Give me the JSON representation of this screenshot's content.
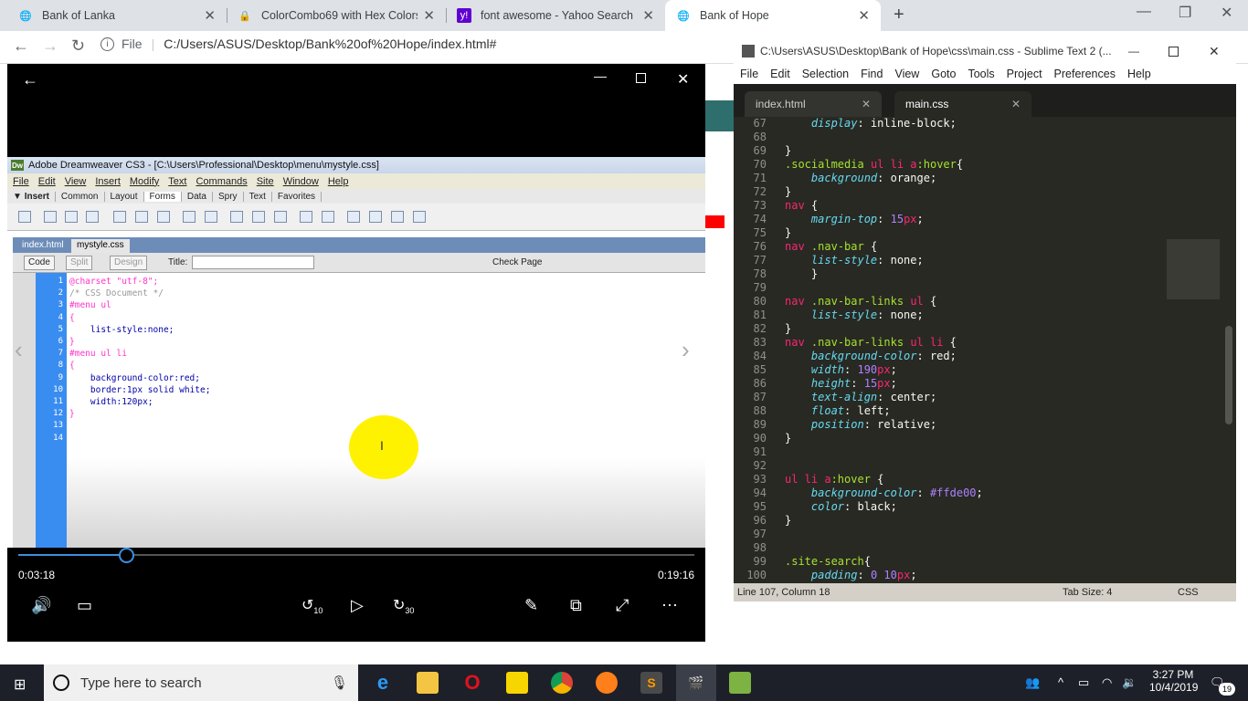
{
  "browser": {
    "tabs": [
      {
        "title": "Bank of Lanka"
      },
      {
        "title": "ColorCombo69 with Hex Colors #"
      },
      {
        "title": "font awesome - Yahoo Search Re"
      },
      {
        "title": "Bank of Hope"
      }
    ],
    "file_label": "File",
    "url": "C:/Users/ASUS/Desktop/Bank%20of%20Hope/index.html#"
  },
  "dreamweaver": {
    "title": "Adobe Dreamweaver CS3 - [C:\\Users\\Professional\\Desktop\\menu\\mystyle.css]",
    "menu": [
      "File",
      "Edit",
      "View",
      "Insert",
      "Modify",
      "Text",
      "Commands",
      "Site",
      "Window",
      "Help"
    ],
    "insert_tabs": [
      "Insert",
      "Common",
      "Layout",
      "Forms",
      "Data",
      "Spry",
      "Text",
      "Favorites"
    ],
    "file_tabs": [
      "index.html",
      "mystyle.css"
    ],
    "view_buttons": [
      "Code",
      "Split",
      "Design"
    ],
    "title_label": "Title:",
    "check_page": "Check Page",
    "line_numbers": "1\n2\n3\n4\n5\n6\n7\n8\n9\n10\n11\n12\n13\n14"
  },
  "player": {
    "elapsed": "0:03:18",
    "duration": "0:19:16",
    "progress": 0.16,
    "skip_back": "10",
    "skip_fwd": "30"
  },
  "sublime": {
    "title": "C:\\Users\\ASUS\\Desktop\\Bank of Hope\\css\\main.css - Sublime Text 2 (...",
    "menu": [
      "File",
      "Edit",
      "Selection",
      "Find",
      "View",
      "Goto",
      "Tools",
      "Project",
      "Preferences",
      "Help"
    ],
    "tabs": [
      "index.html",
      "main.css"
    ],
    "status_left": "Line 107, Column 18",
    "status_tab": "Tab Size: 4",
    "status_syntax": "CSS"
  },
  "taskbar": {
    "search_placeholder": "Type here to search",
    "time": "3:27 PM",
    "date": "10/4/2019",
    "notif_count": "19"
  },
  "colors": {
    "accent": "#3b8fe0",
    "sublime_bg": "#282923",
    "taskbar": "#1d2029"
  }
}
